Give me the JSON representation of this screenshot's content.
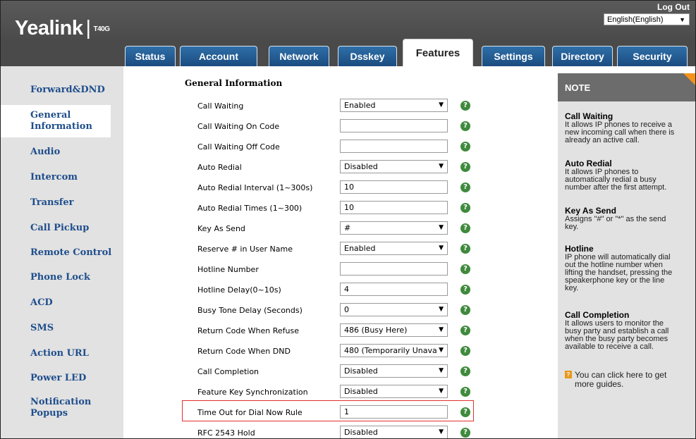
{
  "header": {
    "brand": "Yealink",
    "model": "T40G",
    "logout": "Log Out",
    "language": "English(English)"
  },
  "tabs": [
    {
      "label": "Status"
    },
    {
      "label": "Account"
    },
    {
      "label": "Network"
    },
    {
      "label": "Dsskey"
    },
    {
      "label": "Features",
      "active": true
    },
    {
      "label": "Settings"
    },
    {
      "label": "Directory"
    },
    {
      "label": "Security"
    }
  ],
  "sidebar": {
    "items": [
      {
        "label": "Forward&DND"
      },
      {
        "label": "General\nInformation",
        "active": true
      },
      {
        "label": "Audio"
      },
      {
        "label": "Intercom"
      },
      {
        "label": "Transfer"
      },
      {
        "label": "Call Pickup"
      },
      {
        "label": "Remote Control"
      },
      {
        "label": "Phone Lock"
      },
      {
        "label": "ACD"
      },
      {
        "label": "SMS"
      },
      {
        "label": "Action URL"
      },
      {
        "label": "Power LED"
      },
      {
        "label": "Notification Popups"
      }
    ]
  },
  "main": {
    "section_title": "General Information",
    "rows": [
      {
        "label": "Call Waiting",
        "type": "select",
        "value": "Enabled"
      },
      {
        "label": "Call Waiting On Code",
        "type": "input",
        "value": ""
      },
      {
        "label": "Call Waiting Off Code",
        "type": "input",
        "value": ""
      },
      {
        "label": "Auto Redial",
        "type": "select",
        "value": "Disabled"
      },
      {
        "label": "Auto Redial Interval (1~300s)",
        "type": "input",
        "value": "10"
      },
      {
        "label": "Auto Redial Times (1~300)",
        "type": "input",
        "value": "10"
      },
      {
        "label": "Key As Send",
        "type": "select",
        "value": "#"
      },
      {
        "label": "Reserve # in User Name",
        "type": "select",
        "value": "Enabled"
      },
      {
        "label": "Hotline Number",
        "type": "input",
        "value": ""
      },
      {
        "label": "Hotline Delay(0~10s)",
        "type": "input",
        "value": "4"
      },
      {
        "label": "Busy Tone Delay (Seconds)",
        "type": "select",
        "value": "0"
      },
      {
        "label": "Return Code When Refuse",
        "type": "select",
        "value": "486 (Busy Here)"
      },
      {
        "label": "Return Code When DND",
        "type": "select",
        "value": "480 (Temporarily Unava"
      },
      {
        "label": "Call Completion",
        "type": "select",
        "value": "Disabled"
      },
      {
        "label": "Feature Key Synchronization",
        "type": "select",
        "value": "Disabled"
      },
      {
        "label": "Time Out for Dial Now Rule",
        "type": "input",
        "value": "1"
      },
      {
        "label": "RFC 2543 Hold",
        "type": "select",
        "value": "Disabled"
      }
    ],
    "help_glyph": "?"
  },
  "note": {
    "title": "NOTE",
    "sections": [
      {
        "heading": "Call Waiting",
        "text": "It allows IP phones to receive a\nnew incoming call when there is\nalready an active call."
      },
      {
        "heading": "Auto Redial",
        "text": "It allows IP phones to\nautomatically redial a busy\nnumber after the first attempt."
      },
      {
        "heading": "Key As Send",
        "text": "Assigns \"#\" or \"*\" as the send\nkey."
      },
      {
        "heading": "Hotline",
        "text": "IP phone will automatically dial\nout the hotline number when\nlifting the handset, pressing the\nspeakerphone key or the line\nkey."
      },
      {
        "heading": "Call Completion",
        "text": "It allows users to monitor the\nbusy party and establish a call\nwhen the busy party becomes\navailable to receive a call."
      }
    ],
    "guide_text": "You can click here to get\nmore guides."
  },
  "colors": {
    "header_bg": "#4a4a4a",
    "tab_bg": "#1f5a95",
    "sidebar_link": "#1f4e8c",
    "help_icon": "#3f8a3d",
    "highlight_border": "#e0312f",
    "note_accent": "#f3931c"
  },
  "icons": {
    "help": "question-circle-icon",
    "dropdown": "chevron-down-icon",
    "guide": "guide-book-icon"
  }
}
